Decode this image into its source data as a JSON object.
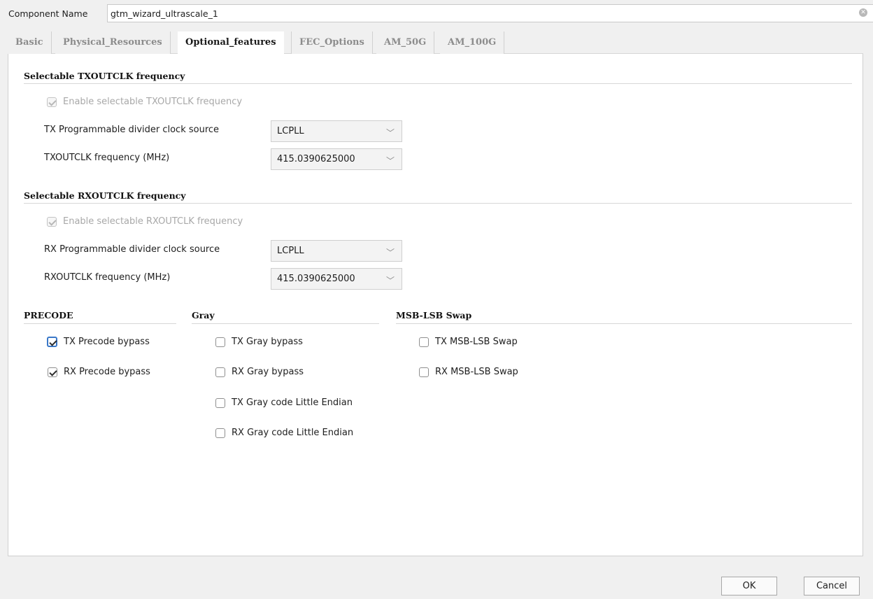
{
  "component": {
    "label": "Component Name",
    "value": "gtm_wizard_ultrascale_1"
  },
  "tabs": [
    {
      "label": "Basic"
    },
    {
      "label": "Physical_Resources"
    },
    {
      "label": "Optional_features"
    },
    {
      "label": "FEC_Options"
    },
    {
      "label": "AM_50G"
    },
    {
      "label": "AM_100G"
    }
  ],
  "active_tab": "Optional_features",
  "txoutclk": {
    "title": "Selectable TXOUTCLK frequency",
    "enable_label": "Enable selectable TXOUTCLK frequency",
    "enable_checked": true,
    "divider_label": "TX Programmable divider clock source",
    "divider_value": "LCPLL",
    "freq_label": "TXOUTCLK frequency (MHz)",
    "freq_value": "415.0390625000"
  },
  "rxoutclk": {
    "title": "Selectable RXOUTCLK frequency",
    "enable_label": "Enable selectable RXOUTCLK frequency",
    "enable_checked": true,
    "divider_label": "RX Programmable divider clock source",
    "divider_value": "LCPLL",
    "freq_label": "RXOUTCLK frequency (MHz)",
    "freq_value": "415.0390625000"
  },
  "precode": {
    "title": "PRECODE",
    "items": [
      {
        "label": "TX Precode bypass",
        "checked": true
      },
      {
        "label": "RX Precode bypass",
        "checked": true
      }
    ]
  },
  "gray": {
    "title": "Gray",
    "items": [
      {
        "label": "TX Gray bypass",
        "checked": false
      },
      {
        "label": "RX Gray bypass",
        "checked": false
      },
      {
        "label": "TX Gray code Little Endian",
        "checked": false
      },
      {
        "label": "RX Gray code Little Endian",
        "checked": false
      }
    ]
  },
  "msblsb": {
    "title": "MSB-LSB Swap",
    "items": [
      {
        "label": "TX MSB-LSB Swap",
        "checked": false
      },
      {
        "label": "RX MSB-LSB Swap",
        "checked": false
      }
    ]
  },
  "buttons": {
    "ok": "OK",
    "cancel": "Cancel"
  },
  "icons": {
    "clear": "clear-icon",
    "chevron": "chevron-down-icon",
    "check": "check-icon"
  }
}
